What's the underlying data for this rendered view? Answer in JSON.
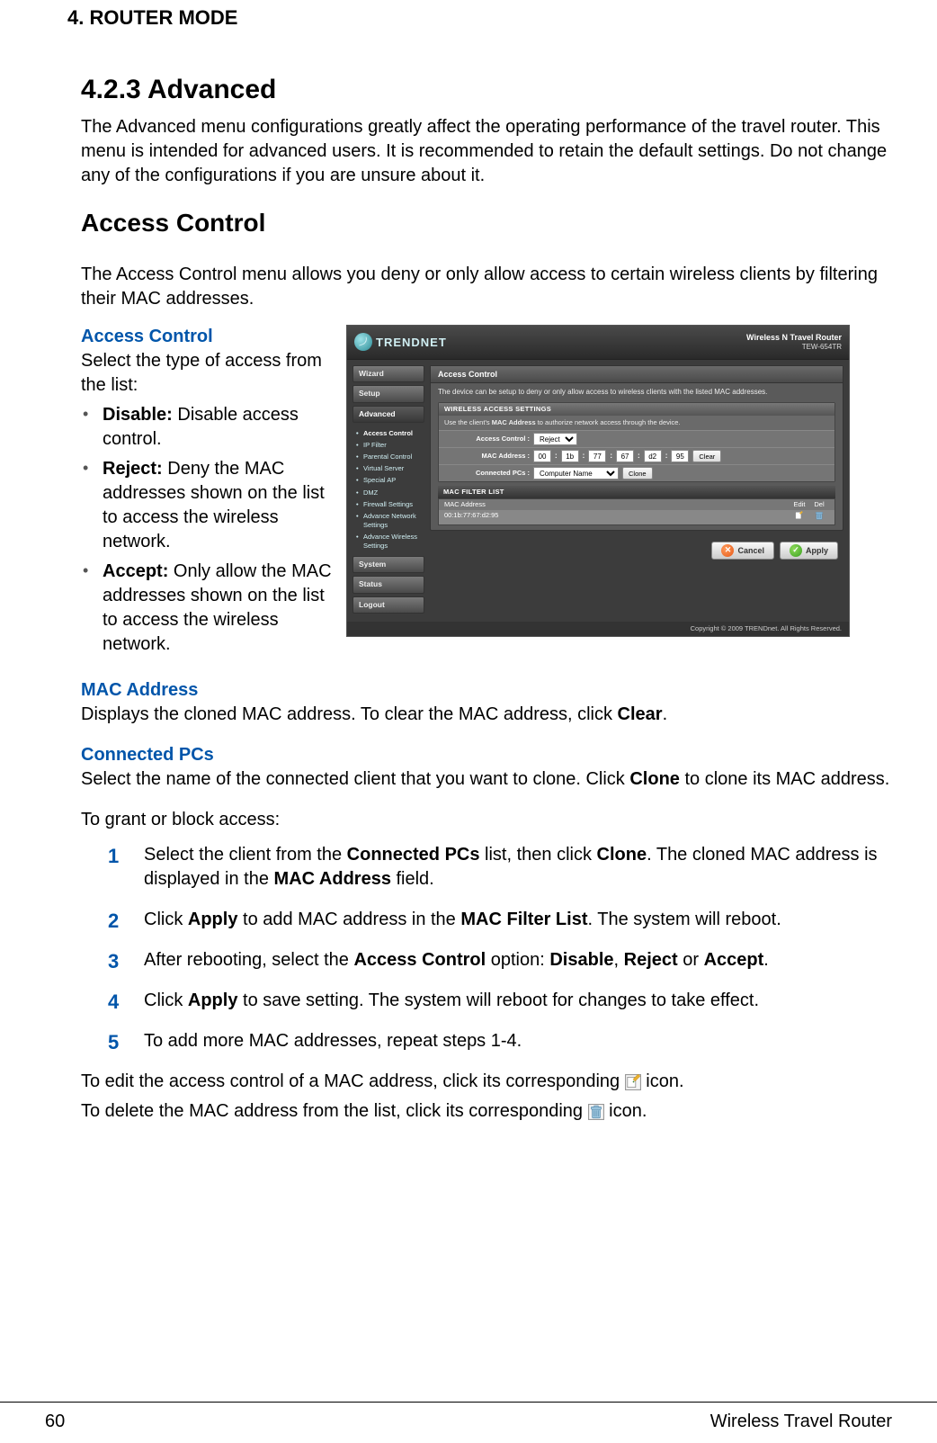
{
  "chapter": "4.  ROUTER MODE",
  "section": {
    "number": "4.2.3",
    "title": "Advanced",
    "intro": "The Advanced menu configurations greatly affect the operating performance of the travel router. This menu is intended for advanced users. It is recommended to retain the default settings. Do not change any of the configurations if you are unsure about it."
  },
  "access_control": {
    "title": "Access Control",
    "desc": "The Access Control menu allows you deny or only allow access to certain wireless clients by filtering their MAC addresses.",
    "heading": "Access Control",
    "select_prompt": "Select the type of access from the list:",
    "options": [
      {
        "label": "Disable:",
        "text": " Disable access control."
      },
      {
        "label": "Reject:",
        "text": " Deny the MAC addresses shown on the list to access the wireless network."
      },
      {
        "label": "Accept:",
        "text": " Only allow the MAC addresses shown on the list to access the wireless network."
      }
    ]
  },
  "mac_address": {
    "heading": "MAC Address",
    "text_pre": "Displays the cloned MAC address. To clear the MAC address, click ",
    "bold": "Clear",
    "text_post": "."
  },
  "connected_pcs": {
    "heading": "Connected PCs",
    "text_p1_pre": "Select the name of the connected client that you want to clone. Click ",
    "text_p1_bold": "Clone",
    "text_p1_post": " to clone its MAC address.",
    "text_p2": "To grant or block access:"
  },
  "steps": [
    {
      "n": "1",
      "parts": [
        "Select the client from the ",
        "Connected PCs",
        " list, then click ",
        "Clone",
        ". The cloned MAC address is displayed in the ",
        "MAC Address",
        " field."
      ]
    },
    {
      "n": "2",
      "parts": [
        "Click ",
        "Apply",
        " to add MAC address in the ",
        "MAC Filter List",
        ". The system will reboot."
      ]
    },
    {
      "n": "3",
      "parts": [
        "After rebooting, select the ",
        "Access Control",
        " option: ",
        "Disable",
        ", ",
        "Reject",
        " or ",
        "Accept",
        "."
      ]
    },
    {
      "n": "4",
      "parts": [
        "Click ",
        "Apply",
        " to save setting. The system will reboot for changes to take effect."
      ]
    },
    {
      "n": "5",
      "parts": [
        "To add more MAC addresses, repeat steps 1-4."
      ]
    }
  ],
  "edit_line_pre": "To edit the access control of a MAC address, click its corresponding ",
  "edit_line_post": " icon.",
  "delete_line_pre": "To delete the MAC address from the list, click its corresponding ",
  "delete_line_post": " icon.",
  "footer": {
    "page": "60",
    "title": "Wireless Travel Router"
  },
  "screenshot": {
    "brand": "TRENDNET",
    "product": "Wireless N Travel Router",
    "model": "TEW-654TR",
    "nav": {
      "wizard": "Wizard",
      "setup": "Setup",
      "advanced": "Advanced",
      "system": "System",
      "status": "Status",
      "logout": "Logout",
      "advanced_items": [
        "Access Control",
        "IP Filter",
        "Parental Control",
        "Virtual Server",
        "Special AP",
        "DMZ",
        "Firewall Settings",
        "Advance Network Settings",
        "Advance Wireless Settings"
      ]
    },
    "panel": {
      "title": "Access Control",
      "desc": "The device can be setup to deny or only allow access to wireless clients with the listed MAC addresses.",
      "settings_title": "WIRELESS ACCESS SETTINGS",
      "settings_desc_pre": "Use the client's ",
      "settings_desc_bold": "MAC Address",
      "settings_desc_post": " to authorize network access through the device.",
      "labels": {
        "access_control": "Access Control :",
        "mac_address": "MAC Address :",
        "connected_pcs": "Connected PCs :"
      },
      "access_control_value": "Reject",
      "mac": [
        "00",
        "1b",
        "77",
        "67",
        "d2",
        "95"
      ],
      "clear_btn": "Clear",
      "connected_pc_value": "Computer Name",
      "clone_btn": "Clone",
      "filter_list_title": "MAC FILTER LIST",
      "filter_header": {
        "addr": "MAC Address",
        "edit": "Edit",
        "del": "Del"
      },
      "filter_row": "00:1b:77:67:d2:95",
      "cancel": "Cancel",
      "apply": "Apply"
    },
    "copyright": "Copyright © 2009 TRENDnet. All Rights Reserved."
  }
}
